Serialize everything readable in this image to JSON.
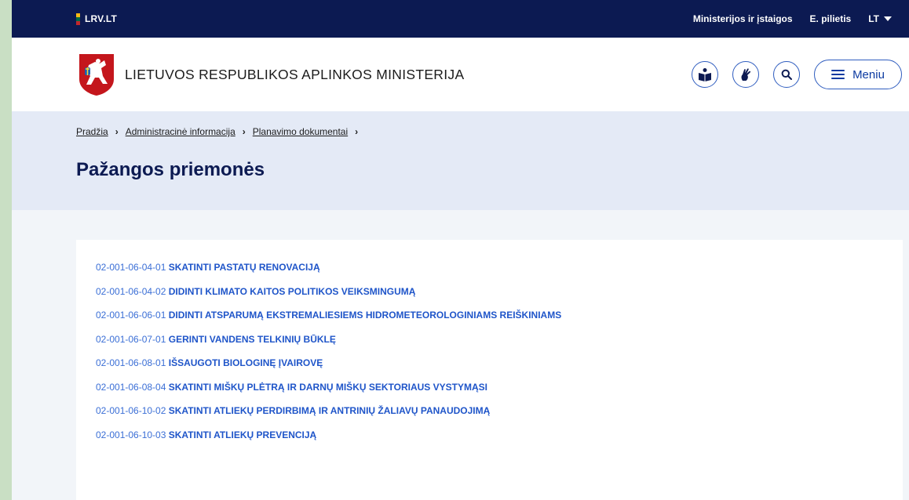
{
  "topbar": {
    "site_label": "LRV.LT",
    "links": [
      {
        "label": "Ministerijos ir įstaigos"
      },
      {
        "label": "E. pilietis"
      }
    ],
    "language": "LT"
  },
  "header": {
    "ministry_name": "LIETUVOS RESPUBLIKOS APLINKOS MINISTERIJA",
    "menu_label": "Meniu"
  },
  "breadcrumb": [
    {
      "label": "Pradžia"
    },
    {
      "label": "Administracinė informacija"
    },
    {
      "label": "Planavimo dokumentai"
    }
  ],
  "page_title": "Pažangos priemonės",
  "items": [
    {
      "code": "02-001-06-04-01",
      "name": "SKATINTI PASTATŲ RENOVACIJĄ"
    },
    {
      "code": "02-001-06-04-02",
      "name": "DIDINTI KLIMATO KAITOS POLITIKOS VEIKSMINGUMĄ"
    },
    {
      "code": "02-001-06-06-01",
      "name": "DIDINTI ATSPARUMĄ EKSTREMALIESIEMS HIDROMETEOROLOGINIAMS REIŠKINIAMS"
    },
    {
      "code": "02-001-06-07-01",
      "name": "GERINTI VANDENS TELKINIŲ BŪKLĘ"
    },
    {
      "code": "02-001-06-08-01",
      "name": "IŠSAUGOTI BIOLOGINĘ ĮVAIROVĘ"
    },
    {
      "code": "02-001-06-08-04",
      "name": "SKATINTI MIŠKŲ PLĖTRĄ IR DARNŲ MIŠKŲ SEKTORIAUS VYSTYMĄSI"
    },
    {
      "code": "02-001-06-10-02",
      "name": "SKATINTI ATLIEKŲ PERDIRBIMĄ IR ANTRINIŲ ŽALIAVŲ PANAUDOJIMĄ"
    },
    {
      "code": "02-001-06-10-03",
      "name": "SKATINTI ATLIEKŲ PREVENCIJĄ"
    }
  ],
  "icons": {
    "flag": "flag-icon",
    "coat_of_arms": "coat-of-arms-icon",
    "easy_read": "easy-read-icon",
    "sign_language": "sign-language-icon",
    "search": "search-icon",
    "menu": "hamburger-icon"
  },
  "colors": {
    "topbar": "#0c1a52",
    "accent": "#2f5dbf",
    "link": "#1f55c9",
    "hero": "#e4eaf6"
  }
}
